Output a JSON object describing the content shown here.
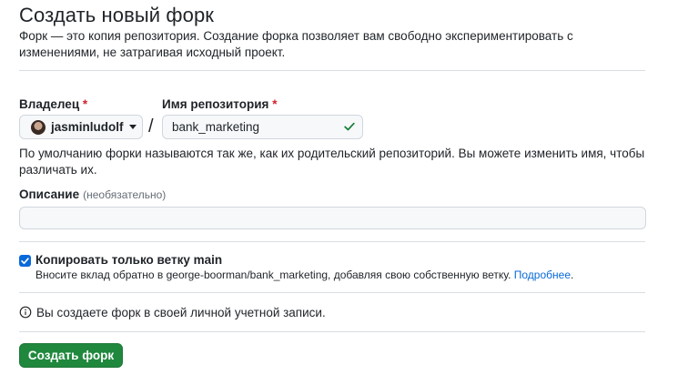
{
  "page": {
    "title": "Создать новый форк",
    "description": "Форк — это копия репозитория. Создание форка позволяет вам свободно экспериментировать с изменениями, не затрагивая исходный проект."
  },
  "owner": {
    "label": "Владелец",
    "required_mark": "*",
    "value": "jasminludolf"
  },
  "separator": "/",
  "repository": {
    "label": "Имя репозитория",
    "required_mark": "*",
    "value": "bank_marketing"
  },
  "name_hint": "По умолчанию форки называются так же, как их родительский репозиторий. Вы можете изменить имя, чтобы различать их.",
  "description_field": {
    "label": "Описание",
    "optional_label": "(необязательно)",
    "value": ""
  },
  "copy_main": {
    "checked": true,
    "label": "Копировать только ветку main",
    "help_text": "Вносите вклад обратно в george-boorman/bank_marketing, добавляя свою собственную ветку. ",
    "help_link": "Подробнее",
    "help_suffix": "."
  },
  "info": {
    "text": "Вы создаете форк в своей личной учетной записи."
  },
  "submit": {
    "label": "Создать форк"
  },
  "colors": {
    "primary_button": "#1f883d",
    "link": "#0969da",
    "required": "#cf222e",
    "success_check": "#1a7f37"
  }
}
